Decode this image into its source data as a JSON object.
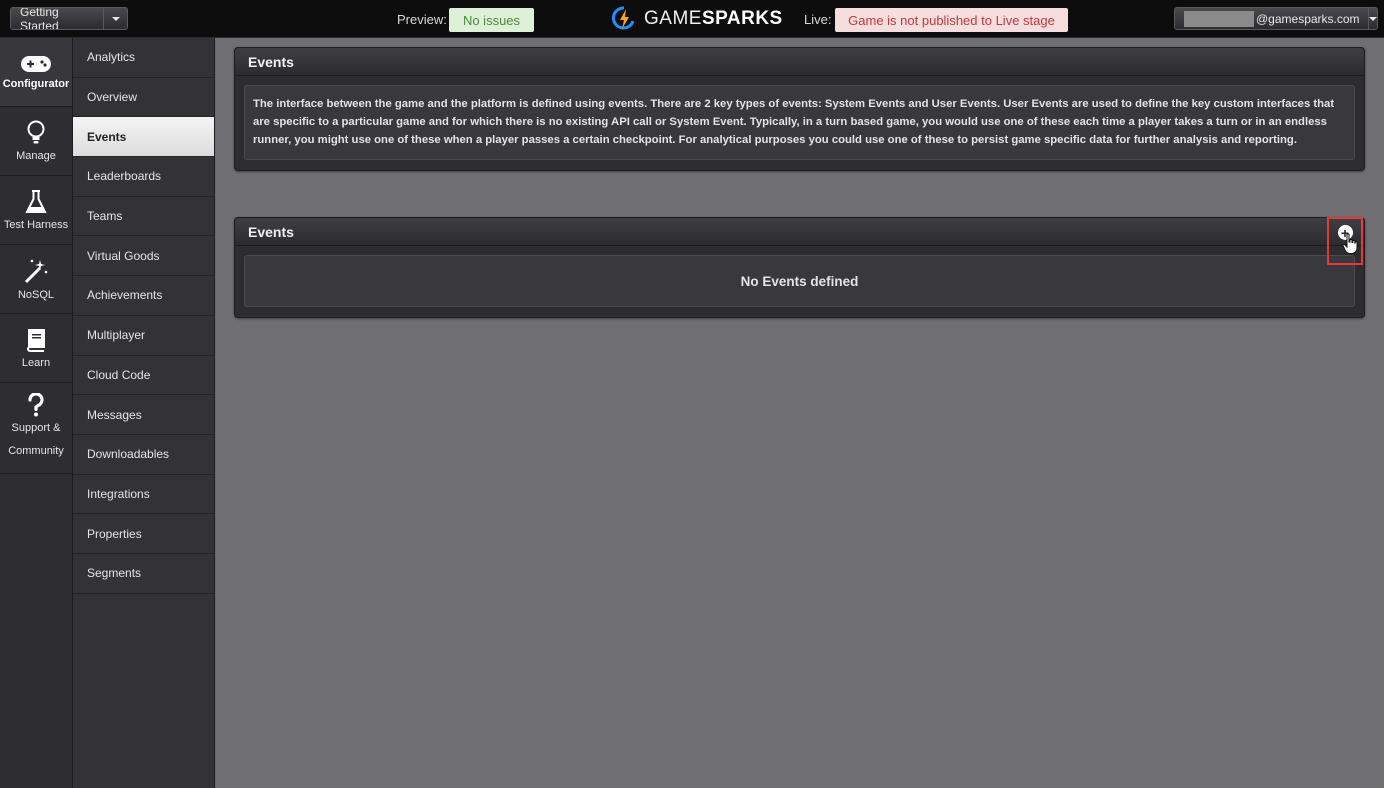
{
  "topbar": {
    "getting_started_label": "Getting Started",
    "preview_label": "Preview:",
    "preview_status": "No issues",
    "logo_game": "GAME",
    "logo_sparks": "SPARKS",
    "live_label": "Live:",
    "live_status": "Game is not published to Live stage",
    "account_suffix": "@gamesparks.com"
  },
  "rail": {
    "items": [
      {
        "label": "Configurator"
      },
      {
        "label": "Manage"
      },
      {
        "label": "Test Harness"
      },
      {
        "label": "NoSQL"
      },
      {
        "label": "Learn"
      },
      {
        "label": "Support & Community"
      }
    ]
  },
  "subnav": {
    "items": [
      {
        "label": "Analytics"
      },
      {
        "label": "Overview"
      },
      {
        "label": "Events"
      },
      {
        "label": "Leaderboards"
      },
      {
        "label": "Teams"
      },
      {
        "label": "Virtual Goods"
      },
      {
        "label": "Achievements"
      },
      {
        "label": "Multiplayer"
      },
      {
        "label": "Cloud Code"
      },
      {
        "label": "Messages"
      },
      {
        "label": "Downloadables"
      },
      {
        "label": "Integrations"
      },
      {
        "label": "Properties"
      },
      {
        "label": "Segments"
      }
    ]
  },
  "main": {
    "info_panel": {
      "title": "Events",
      "description": "The interface between the game and the platform is defined using events. There are 2 key types of events: System Events and User Events. User Events are used to define the key custom interfaces that are specific to a particular game and for which there is no existing API call or System Event. Typically, in a turn based game, you would use one of these each time a player takes a turn or in an endless runner, you might use one of these when a player passes a certain checkpoint. For analytical purposes you could use one of these to persist game specific data for further analysis and reporting."
    },
    "events_panel": {
      "title": "Events",
      "empty_text": "No Events defined",
      "add_symbol": "+"
    }
  },
  "colors": {
    "preview_ok_bg": "#dff0d8",
    "live_warn_bg": "#f6dede",
    "highlight": "#e53935",
    "logo_accent": "#1e90ff"
  }
}
